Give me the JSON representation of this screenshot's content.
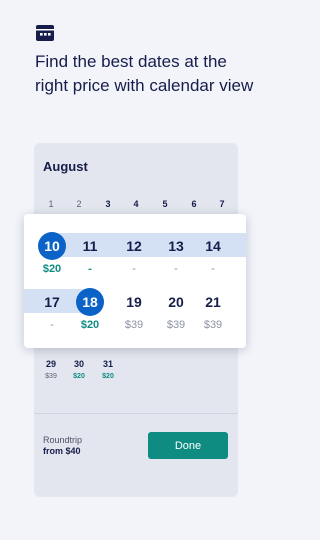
{
  "headline": "Find the best dates at the right price with calendar view",
  "calendar": {
    "month": "August",
    "day_numbers": [
      "1",
      "2",
      "3",
      "4",
      "5",
      "6",
      "7"
    ],
    "last_row": [
      {
        "day": "29",
        "price": "$39"
      },
      {
        "day": "30",
        "price": "$20"
      },
      {
        "day": "31",
        "price": "$20"
      }
    ],
    "zoom_week1": [
      {
        "day": "10",
        "price": "$20"
      },
      {
        "day": "11",
        "price": "-"
      },
      {
        "day": "12",
        "price": "-"
      },
      {
        "day": "13",
        "price": "-"
      },
      {
        "day": "14",
        "price": "-"
      }
    ],
    "zoom_week2": [
      {
        "day": "17",
        "price": "-"
      },
      {
        "day": "18",
        "price": "$20"
      },
      {
        "day": "19",
        "price": "$39"
      },
      {
        "day": "20",
        "price": "$39"
      },
      {
        "day": "21",
        "price": "$39"
      }
    ]
  },
  "footer": {
    "roundtrip_label": "Roundtrip",
    "from_price": "from $40",
    "done_label": "Done"
  },
  "colors": {
    "accent_blue": "#0b62c7",
    "price_green": "#0f8c82",
    "range_band": "#d4e1f4",
    "text_navy": "#161d4b"
  },
  "icons": {
    "top": "calendar-icon"
  }
}
